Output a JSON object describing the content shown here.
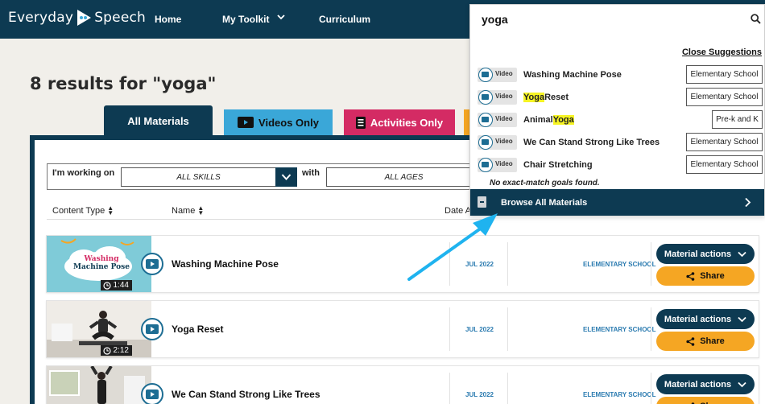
{
  "nav": {
    "brand_left": "Everyday",
    "brand_right": "Speech",
    "home": "Home",
    "toolkit": "My Toolkit",
    "curriculum": "Curriculum"
  },
  "results_title": "8 results for \"yoga\"",
  "tabs": {
    "all": "All Materials",
    "videos": "Videos Only",
    "activities": "Activities Only"
  },
  "filters": {
    "working_on_label": "I'm working on",
    "skills_value": "ALL SKILLS",
    "with_label": "with",
    "ages_value": "ALL AGES"
  },
  "sort": {
    "content_type": "Content Type",
    "name": "Name",
    "date": "Date A"
  },
  "results": [
    {
      "title": "Washing Machine Pose",
      "thumb_text": [
        "Washing",
        "Machine Pose"
      ],
      "duration": "1:44",
      "date": "JUL 2022",
      "age": "ELEMENTARY SCHOOL"
    },
    {
      "title": "Yoga Reset",
      "duration": "2:12",
      "date": "JUL 2022",
      "age": "ELEMENTARY SCHOOL"
    },
    {
      "title": "We Can Stand Strong Like Trees",
      "date": "JUL 2022",
      "age": "ELEMENTARY SCHOOL"
    }
  ],
  "row_buttons": {
    "actions": "Material actions",
    "share": "Share"
  },
  "search": {
    "query": "yoga",
    "close_label": "Close Suggestions",
    "video_tag": "Video",
    "suggestions": [
      {
        "pre": "Washing Machine Pose",
        "hl": "",
        "post": "",
        "age": "Elementary School"
      },
      {
        "pre": "",
        "hl": "Yoga",
        "post": "Reset",
        "age": "Elementary School"
      },
      {
        "pre": "Animal",
        "hl": "Yoga",
        "post": "",
        "age": "Pre-k and K"
      },
      {
        "pre": "We Can Stand Strong Like Trees",
        "hl": "",
        "post": "",
        "age": "Elementary School"
      },
      {
        "pre": "Chair Stretching",
        "hl": "",
        "post": "",
        "age": "Elementary School"
      }
    ],
    "no_match": "No exact-match goals found.",
    "browse_label": "Browse All Materials"
  },
  "colors": {
    "navy": "#0d3a52",
    "blue": "#3aa7d8",
    "magenta": "#d42b64",
    "orange": "#f5a623",
    "highlight": "#f6f423",
    "annotation_arrow": "#1fb3ef"
  },
  "icons": [
    "play-logo-icon",
    "chevron-down-icon",
    "search-icon",
    "sort-icon",
    "clock-icon",
    "video-icon",
    "activity-icon",
    "share-icon",
    "browse-icon",
    "chevron-right-icon"
  ]
}
